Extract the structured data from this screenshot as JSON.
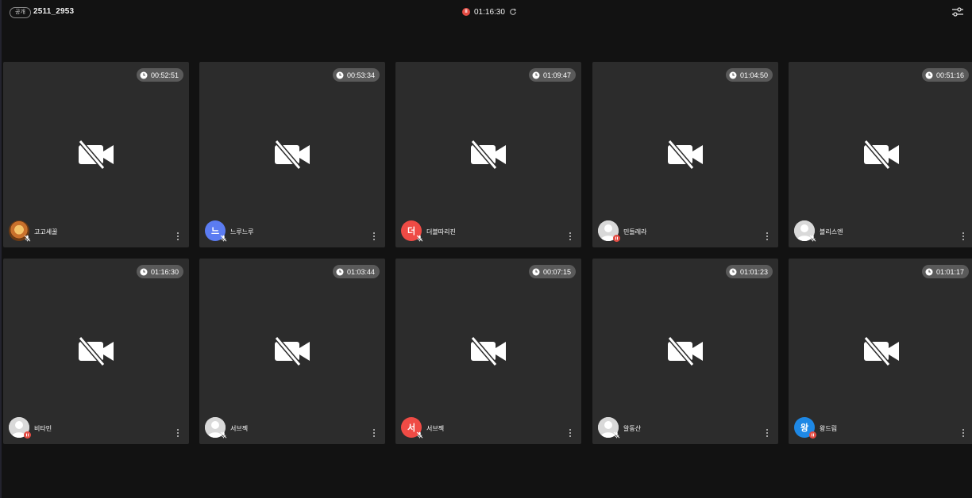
{
  "header": {
    "visibility_badge": "공개",
    "room_name": "2511_2953",
    "elapsed_time": "01:16:30",
    "settings_icon": "sliders-icon"
  },
  "colors": {
    "recording": "#e34b43",
    "tile_bg": "#2c2c2c",
    "page_bg": "#121212"
  },
  "participants": [
    {
      "name": "고고세꿀",
      "duration": "00:52:51",
      "avatar_type": "photo",
      "avatar_letter": "",
      "avatar_color": "#b8732e",
      "mic": "muted"
    },
    {
      "name": "느루느루",
      "duration": "00:53:34",
      "avatar_type": "letter",
      "avatar_letter": "느",
      "avatar_color": "#5b7cf2",
      "mic": "muted"
    },
    {
      "name": "더블따리진",
      "duration": "01:09:47",
      "avatar_type": "letter",
      "avatar_letter": "더",
      "avatar_color": "#ef4b45",
      "mic": "muted"
    },
    {
      "name": "민들레라",
      "duration": "01:04:50",
      "avatar_type": "default",
      "avatar_letter": "",
      "avatar_color": "#d7d7d7",
      "mic": "recording"
    },
    {
      "name": "블리스엔",
      "duration": "00:51:16",
      "avatar_type": "default",
      "avatar_letter": "",
      "avatar_color": "#d7d7d7",
      "mic": "muted"
    },
    {
      "name": "비타민",
      "duration": "01:16:30",
      "avatar_type": "default",
      "avatar_letter": "",
      "avatar_color": "#d7d7d7",
      "mic": "recording"
    },
    {
      "name": "서브젝",
      "duration": "01:03:44",
      "avatar_type": "default",
      "avatar_letter": "",
      "avatar_color": "#d7d7d7",
      "mic": "muted"
    },
    {
      "name": "서브젝",
      "duration": "00:07:15",
      "avatar_type": "letter",
      "avatar_letter": "서",
      "avatar_color": "#ef4b45",
      "mic": "muted"
    },
    {
      "name": "알동산",
      "duration": "01:01:23",
      "avatar_type": "default",
      "avatar_letter": "",
      "avatar_color": "#d7d7d7",
      "mic": "muted"
    },
    {
      "name": "왕드림",
      "duration": "01:01:17",
      "avatar_type": "letter",
      "avatar_letter": "왕",
      "avatar_color": "#1e88e5",
      "mic": "recording"
    }
  ]
}
